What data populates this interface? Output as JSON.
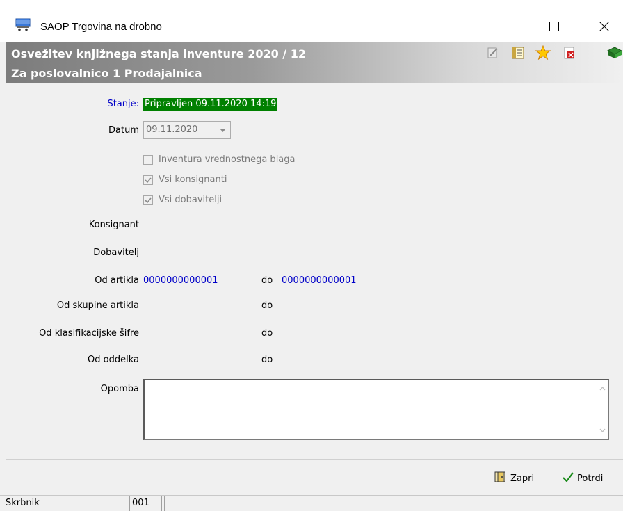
{
  "window": {
    "app_title": "SAOP Trgovina na drobno",
    "minimize_glyph": "—",
    "maximize_glyph": "☐",
    "close_glyph": "✕"
  },
  "header": {
    "title_line1": "Osvežitev knjižnega stanja inventure 2020 / 12",
    "title_line2": "Za poslovalnico 1 Prodajalnica",
    "toolbar_icons": [
      "edit-icon",
      "list-icon",
      "star-icon",
      "delete-icon",
      "book-icon"
    ]
  },
  "form": {
    "status_label": "Stanje:",
    "status_value": "Pripravljen 09.11.2020 14:19",
    "date_label": "Datum",
    "date_value": "09.11.2020",
    "checkbox_valuable_label": "Inventura vrednostnega blaga",
    "checkbox_valuable_checked": false,
    "checkbox_consignors_label": "Vsi konsignanti",
    "checkbox_consignors_checked": true,
    "checkbox_suppliers_label": "Vsi dobavitelji",
    "checkbox_suppliers_checked": true,
    "consignor_label": "Konsignant",
    "supplier_label": "Dobavitelj",
    "article_from_label": "Od artikla",
    "article_from_value": "0000000000001",
    "article_to_label": "do",
    "article_to_value": "0000000000001",
    "group_from_label": "Od skupine artikla",
    "group_to_label": "do",
    "class_from_label": "Od klasifikacijske šifre",
    "class_to_label": "do",
    "dept_from_label": "Od oddelka",
    "dept_to_label": "do",
    "note_label": "Opomba",
    "note_value": ""
  },
  "footer": {
    "close_button": "Zapri",
    "confirm_button": "Potrdi"
  },
  "statusbar": {
    "user": "Skrbnik",
    "code": "001"
  },
  "colors": {
    "status_bg": "#008000",
    "link_blue": "#0000c8"
  }
}
